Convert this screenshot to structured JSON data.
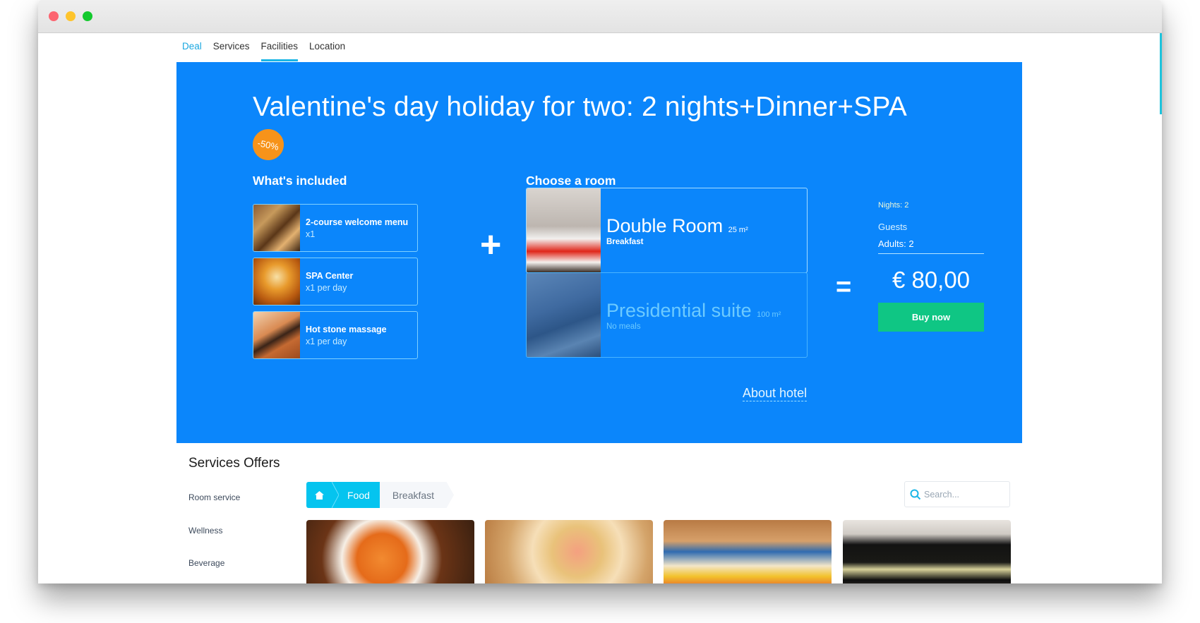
{
  "window": {
    "traffic_lights": [
      "close",
      "minimize",
      "maximize"
    ]
  },
  "nav": {
    "items": [
      {
        "label": "Deal",
        "active": true
      },
      {
        "label": "Services"
      },
      {
        "label": "Facilities",
        "underlined": true
      },
      {
        "label": "Location"
      }
    ]
  },
  "hero": {
    "title": "Valentine's day holiday for two: 2 nights+Dinner+SPA",
    "badge": "-50%",
    "included_heading": "What's included",
    "included": [
      {
        "name": "2-course welcome menu",
        "qty": "x1",
        "image": "restaurant-table-photo"
      },
      {
        "name": "SPA Center",
        "qty": "x1 per day",
        "image": "spa-room-photo"
      },
      {
        "name": "Hot stone massage",
        "qty": "x1 per day",
        "image": "massage-photo"
      }
    ],
    "plus_symbol": "+",
    "rooms_heading": "Choose a room",
    "rooms": [
      {
        "name": "Double Room",
        "area": "25 m²",
        "meal": "Breakfast",
        "selected": true,
        "image": "double-room-photo"
      },
      {
        "name": "Presidential suite",
        "area": "100 m²",
        "meal": "No meals",
        "selected": false,
        "image": "presidential-suite-photo"
      }
    ],
    "about_link": "About hotel",
    "equals_symbol": "=",
    "summary": {
      "nights": "Nights: 2",
      "guests_label": "Guests",
      "adults": "Adults: 2",
      "price": "€ 80,00",
      "buy_label": "Buy now"
    }
  },
  "services": {
    "title": "Services Offers",
    "sidebar": [
      "Room service",
      "Wellness",
      "Beverage"
    ],
    "breadcrumb": {
      "home_icon": "home-icon",
      "items": [
        "Food",
        "Breakfast"
      ]
    },
    "search_placeholder": "Search...",
    "cards": [
      {
        "image": "fried-food-bowl-photo"
      },
      {
        "image": "breakfast-plate-photo"
      },
      {
        "image": "egg-dish-photo"
      },
      {
        "image": "tea-cups-photo"
      }
    ]
  },
  "colors": {
    "hero_bg": "#0b86fb",
    "accent": "#05c4ef",
    "badge": "#f7931a",
    "buy_button": "#0fc684",
    "nav_active": "#1aa7e0"
  }
}
